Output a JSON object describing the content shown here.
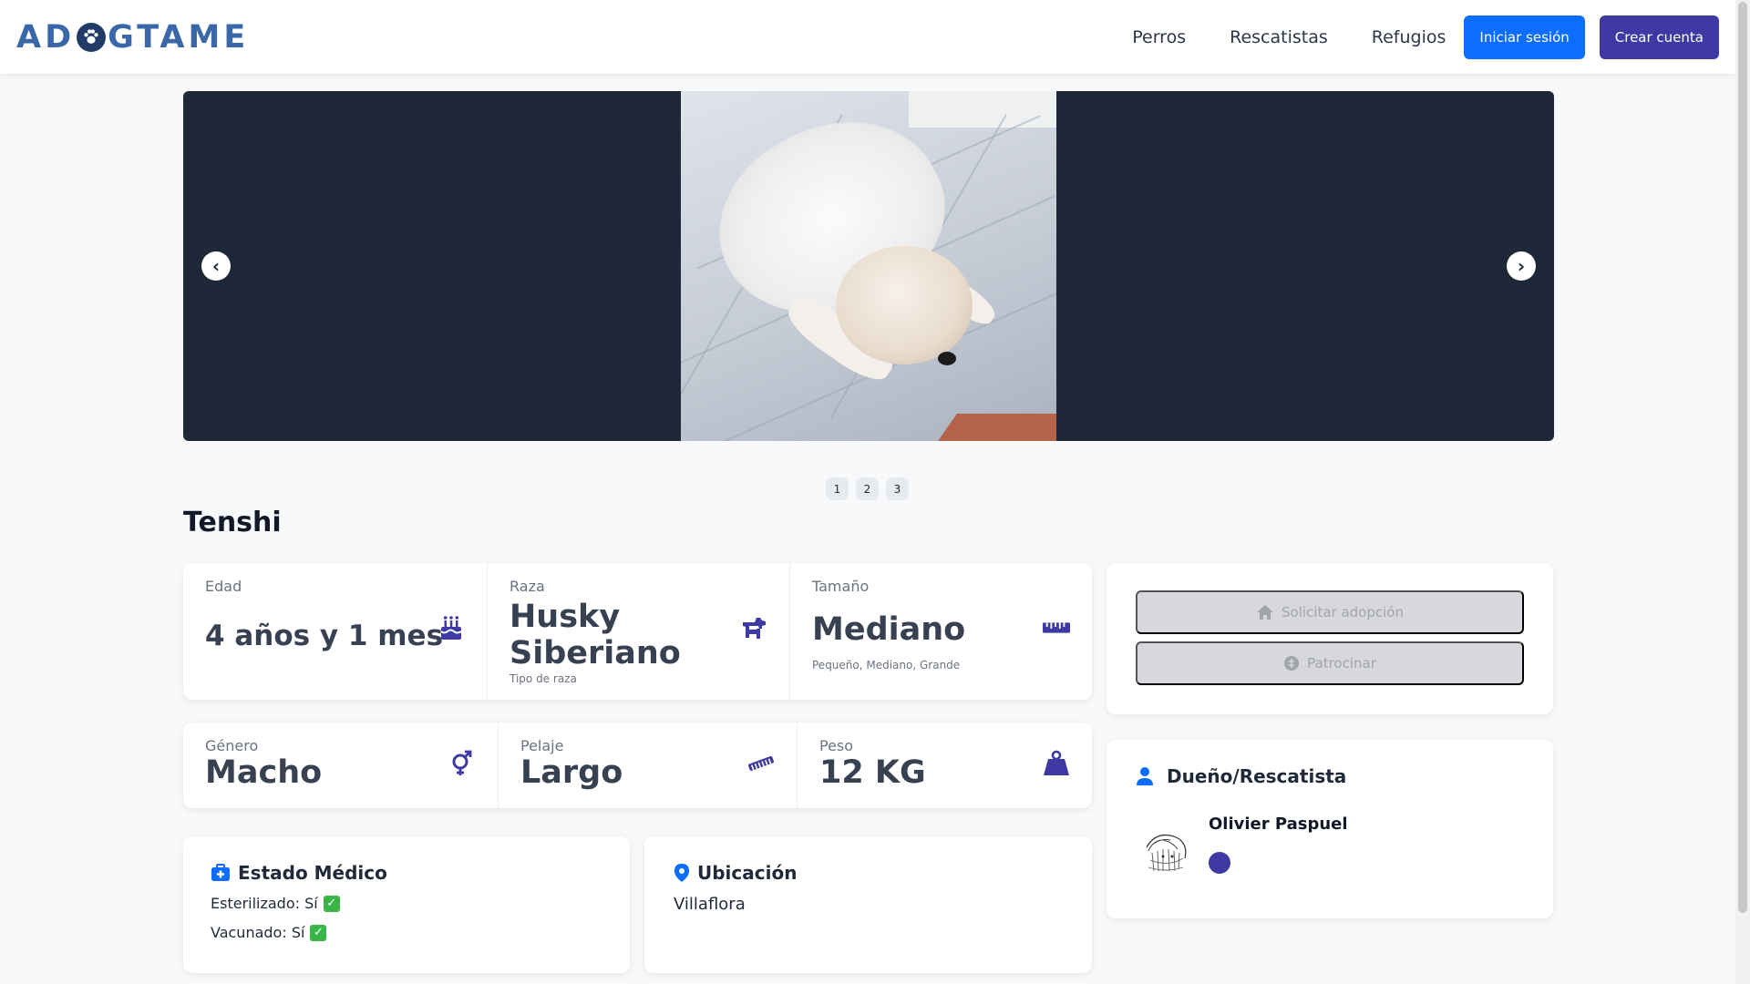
{
  "brand": {
    "logo_left": "AD",
    "logo_right": "GTAME"
  },
  "nav": {
    "links": [
      "Perros",
      "Rescatistas",
      "Refugios"
    ],
    "login_label": "Iniciar sesión",
    "signup_label": "Crear cuenta"
  },
  "carousel": {
    "prev_label": "‹",
    "next_label": "›",
    "pages": [
      "1",
      "2",
      "3"
    ]
  },
  "dog": {
    "name": "Tenshi",
    "age": {
      "label": "Edad",
      "value": "4 años y 1 mes"
    },
    "breed": {
      "label": "Raza",
      "value": "Husky Siberiano",
      "sub": "Tipo de raza"
    },
    "size": {
      "label": "Tamaño",
      "value": "Mediano",
      "sub": "Pequeño, Mediano, Grande"
    },
    "gender": {
      "label": "Género",
      "value": "Macho"
    },
    "coat": {
      "label": "Pelaje",
      "value": "Largo"
    },
    "weight": {
      "label": "Peso",
      "value": "12 KG"
    }
  },
  "actions": {
    "adopt_label": "Solicitar adopción",
    "sponsor_label": "Patrocinar"
  },
  "owner": {
    "title": "Dueño/Rescatista",
    "name": "Olivier Paspuel"
  },
  "medical": {
    "title": "Estado Médico",
    "sterilized": "Esterilizado: Sí",
    "vaccinated": "Vacunado: Sí"
  },
  "location": {
    "title": "Ubicación",
    "value": "Villaflora"
  },
  "colors": {
    "primary": "#0d6efd",
    "accent": "#3f3aa3",
    "carousel_bg": "#1e2838",
    "disabled": "#d6d8db"
  }
}
